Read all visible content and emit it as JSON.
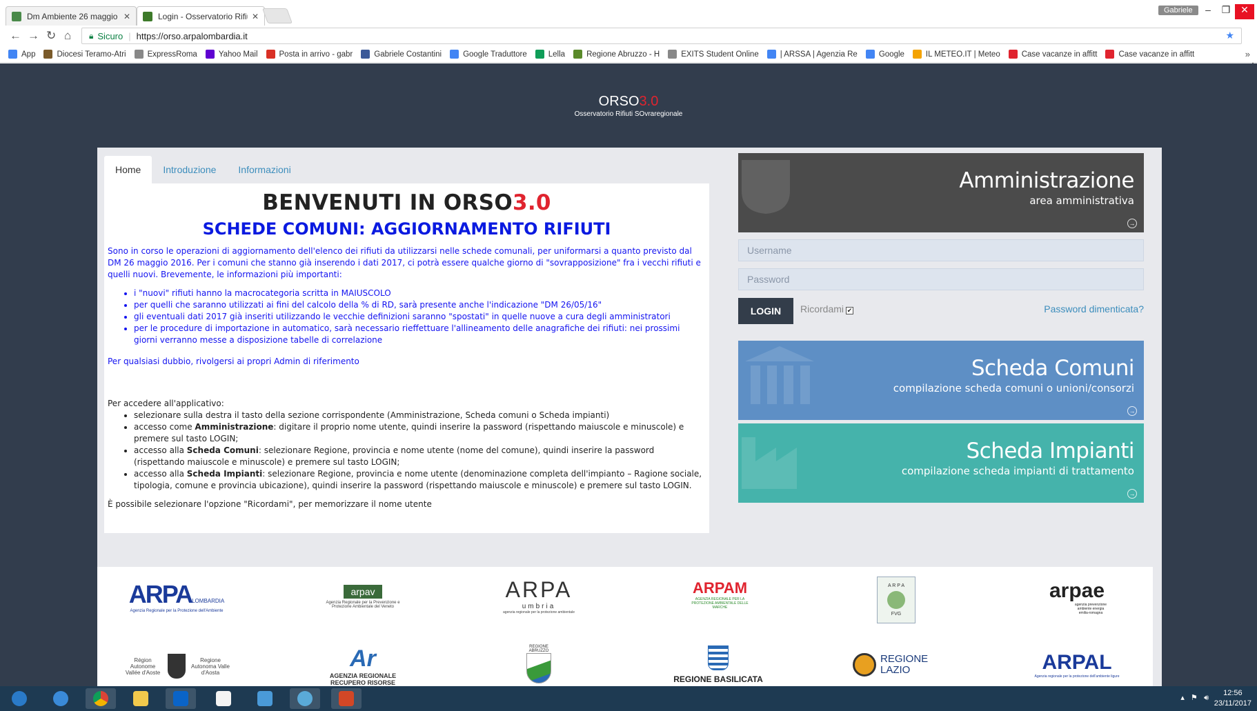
{
  "browser": {
    "tabs": [
      {
        "title": "Dm Ambiente 26 maggio",
        "color": "#4a8a4a"
      },
      {
        "title": "Login - Osservatorio Rifiuti",
        "color": "#3d7a2a"
      }
    ],
    "user": "Gabriele",
    "security_label": "Sicuro",
    "url": "https://orso.arpalombardia.it",
    "bookmarks": [
      {
        "label": "App",
        "color": "#4285f4"
      },
      {
        "label": "Diocesi Teramo-Atri",
        "color": "#7a5a2a"
      },
      {
        "label": "ExpressRoma",
        "color": "#888888"
      },
      {
        "label": "Yahoo Mail",
        "color": "#5f01d1"
      },
      {
        "label": "Posta in arrivo - gabr",
        "color": "#d93025"
      },
      {
        "label": "Gabriele Costantini",
        "color": "#3b5998"
      },
      {
        "label": "Google Traduttore",
        "color": "#4285f4"
      },
      {
        "label": "Lella",
        "color": "#0f9d58"
      },
      {
        "label": "Regione Abruzzo - H",
        "color": "#5a8a2a"
      },
      {
        "label": "EXITS Student Online",
        "color": "#888888"
      },
      {
        "label": "| ARSSA | Agenzia Re",
        "color": "#4285f4"
      },
      {
        "label": "Google",
        "color": "#4285f4"
      },
      {
        "label": "IL METEO.IT | Meteo",
        "color": "#f4a300"
      },
      {
        "label": "Case vacanze in affitt",
        "color": "#e0242f"
      },
      {
        "label": "Case vacanze in affitt",
        "color": "#e0242f"
      }
    ]
  },
  "site": {
    "logo_main": "ORSO",
    "logo_version": "3.0",
    "logo_sub": "Osservatorio Rifiuti SOvraregionale"
  },
  "tabs": [
    "Home",
    "Introduzione",
    "Informazioni"
  ],
  "content": {
    "heading_main": "BENVENUTI IN ORSO",
    "heading_version": "3.0",
    "subheading": "SCHEDE COMUNI: AGGIORNAMENTO RIFIUTI",
    "intro": "Sono in corso le operazioni di aggiornamento dell'elenco dei rifiuti da utilizzarsi nelle schede comunali, per uniformarsi a quanto previsto dal DM 26 maggio 2016. Per i comuni che stanno già inserendo i dati 2017, ci potrà essere qualche giorno di \"sovrapposizione\" fra i vecchi rifiuti e quelli nuovi. Brevemente, le informazioni più importanti:",
    "bullets": [
      "i \"nuovi\" rifiuti hanno la macrocategoria scritta in MAIUSCOLO",
      "per quelli che saranno utilizzati ai fini del calcolo della % di RD, sarà presente anche l'indicazione \"DM 26/05/16\"",
      "gli eventuali dati 2017 già inseriti utilizzando le vecchie definizioni saranno \"spostati\" in quelle nuove a cura degli amministratori",
      "per le procedure di importazione in automatico, sarà necessario rieffettuare l'allineamento delle anagrafiche dei rifiuti: nei prossimi giorni verranno messe a disposizione tabelle di correlazione"
    ],
    "doubt": "Per qualsiasi dubbio, rivolgersi ai propri Admin di riferimento",
    "access_intro": "Per accedere all'applicativo:",
    "access_1": "selezionare sulla destra il tasto della sezione corrispondente (Amministrazione, Scheda comuni o Scheda impianti)",
    "access_2_pre": "accesso come ",
    "access_2_bold": "Amministrazione",
    "access_2_post": ": digitare il proprio nome utente, quindi inserire la password (rispettando maiuscole e minuscole) e premere sul tasto LOGIN;",
    "access_3_pre": "accesso alla ",
    "access_3_bold": "Scheda Comuni",
    "access_3_post": ": selezionare Regione, provincia e nome utente (nome del comune), quindi inserire la password (rispettando maiuscole e minuscole) e premere sul tasto LOGIN;",
    "access_4_pre": "accesso alla ",
    "access_4_bold": "Scheda Impianti",
    "access_4_post": ": selezionare Regione, provincia e nome utente (denominazione completa dell'impianto – Ragione sociale, tipologia, comune e provincia ubicazione), quindi inserire la password (rispettando maiuscole e minuscole) e premere sul tasto LOGIN.",
    "remember_note": "È possibile selezionare l'opzione \"Ricordami\", per memorizzare il nome utente"
  },
  "admin": {
    "title": "Amministrazione",
    "subtitle": "area amministrativa"
  },
  "login": {
    "username_placeholder": "Username",
    "password_placeholder": "Password",
    "button": "LOGIN",
    "remember": "Ricordami",
    "forgot": "Password dimenticata?"
  },
  "comuni": {
    "title": "Scheda Comuni",
    "subtitle": "compilazione scheda comuni o unioni/consorzi"
  },
  "impianti": {
    "title": "Scheda Impianti",
    "subtitle": "compilazione scheda impianti di trattamento"
  },
  "partners": {
    "arpa_lombardia": {
      "name": "ARPA",
      "tag": "LOMBARDIA",
      "desc": "Agenzia Regionale per la Protezione dell'Ambiente"
    },
    "arpav": {
      "name": "arpav",
      "desc": "Agenzia Regionale per la Prevenzione e Protezione Ambientale del Veneto"
    },
    "arpa_umbria": {
      "name": "ARPA",
      "tag": "umbria",
      "desc": "agenzia regionale per la protezione ambientale"
    },
    "arpam": {
      "name": "ARPAM",
      "desc": "AGENZIA REGIONALE PER LA PROTEZIONE AMBIENTALE DELLE MARCHE"
    },
    "arpa_fvg": {
      "name": "A R P A",
      "tag": "FVG"
    },
    "arpae": {
      "name": "arpae",
      "desc": "agenzia prevenzione ambiente energia emilia-romagna"
    },
    "vda": {
      "name1": "Région Autonome Vallée d'Aoste",
      "name2": "Regione Autonoma Valle d'Aosta"
    },
    "arr": {
      "name": "AGENZIA REGIONALE RECUPERO RISORSE"
    },
    "abruzzo": {
      "name": "REGIONE ABRUZZO"
    },
    "basilicata": {
      "name": "REGIONE BASILICATA"
    },
    "lazio": {
      "name": "REGIONE LAZIO"
    },
    "arpal": {
      "name": "ARPAL",
      "desc": "Agenzia regionale per la protezione dell'ambiente ligure"
    }
  },
  "taskbar": {
    "time": "12:56",
    "date": "23/11/2017"
  }
}
